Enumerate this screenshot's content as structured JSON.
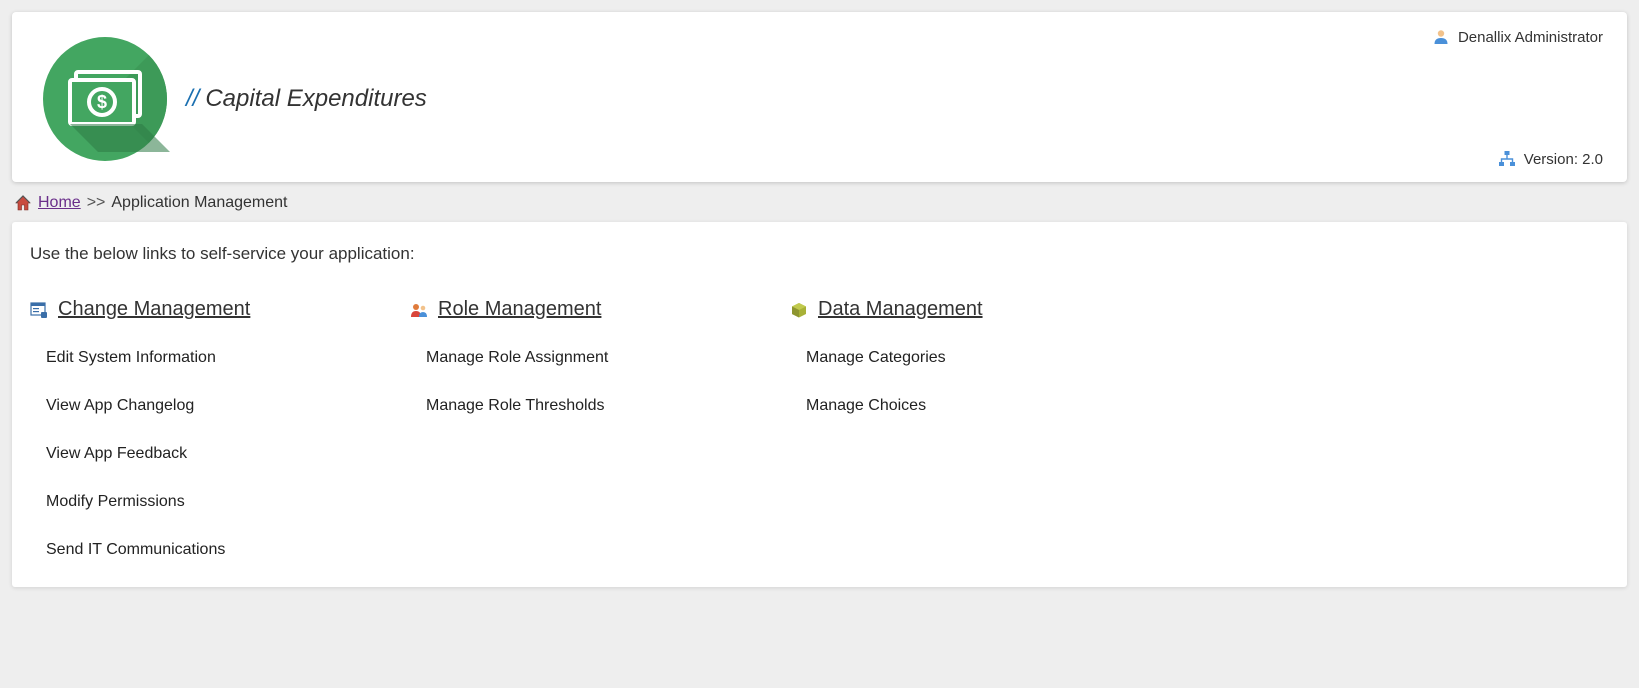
{
  "header": {
    "slashes": "//",
    "title": "Capital Expenditures",
    "user_name": "Denallix Administrator",
    "version_label": "Version: 2.0"
  },
  "breadcrumb": {
    "home": "Home",
    "separator": ">>",
    "current": "Application Management"
  },
  "intro": "Use the below links to self-service your application:",
  "sections": {
    "change": {
      "title": "Change Management",
      "links": [
        "Edit System Information",
        "View App Changelog",
        "View App Feedback",
        "Modify Permissions",
        "Send IT Communications"
      ]
    },
    "role": {
      "title": "Role Management",
      "links": [
        "Manage Role Assignment",
        "Manage Role Thresholds"
      ]
    },
    "data": {
      "title": "Data Management",
      "links": [
        "Manage Categories",
        "Manage Choices"
      ]
    }
  }
}
